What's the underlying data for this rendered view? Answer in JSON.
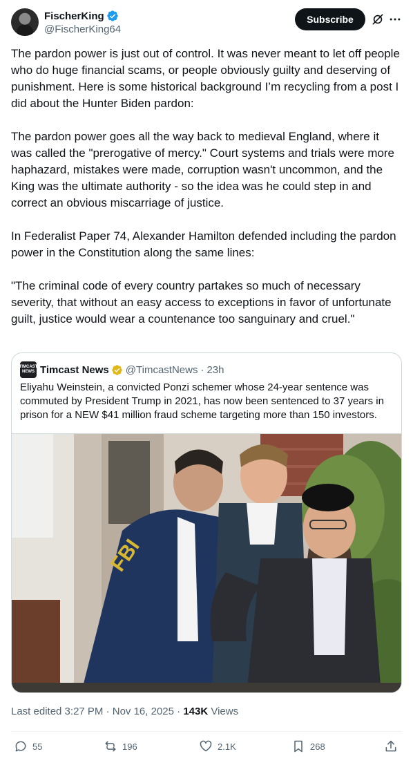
{
  "header": {
    "display_name": "FischerKing",
    "handle": "@FischerKing64",
    "subscribe_label": "Subscribe"
  },
  "tweet": {
    "paragraphs": [
      "The pardon power is just out of control. It was never meant to let off people who do huge financial scams, or people obviously guilty and deserving of punishment. Here is some historical background I’m recycling from a post I did about the Hunter Biden pardon:",
      "The pardon power goes all the way back to medieval England, where it was called the \"prerogative of mercy.\" Court systems and trials were more haphazard, mistakes were made, corruption wasn't uncommon, and the King was the ultimate authority - so the idea was he could step in and correct an obvious miscarriage of justice.",
      "In Federalist Paper 74, Alexander Hamilton defended including the pardon power in the Constitution along the same lines:",
      "\"The criminal code of every country partakes so much of necessary severity, that without an easy access to exceptions in favor of unfortunate guilt, justice would wear a countenance too sanguinary and cruel.\""
    ]
  },
  "quote": {
    "avatar_text": "TIMCAST NEWS",
    "name": "Timcast News",
    "handle": "@TimcastNews",
    "separator": "·",
    "time": "23h",
    "text": "Eliyahu Weinstein, a convicted Ponzi schemer whose 24-year sentence was commuted by President Trump in 2021, has now been sentenced to 37 years in prison for a NEW $41 million fraud scheme targeting more than 150 investors.",
    "image_fbi_text": "FBI"
  },
  "meta": {
    "edited": "Last edited 3:27 PM · Nov 16, 2025 · ",
    "views_count": "143K",
    "views_label": " Views"
  },
  "actions": {
    "replies": "55",
    "reposts": "196",
    "likes": "2.1K",
    "bookmarks": "268"
  },
  "colors": {
    "accent_verified": "#1d9bf0",
    "gold_badge": "#e2b719",
    "text_primary": "#0f1419",
    "text_secondary": "#536471"
  }
}
